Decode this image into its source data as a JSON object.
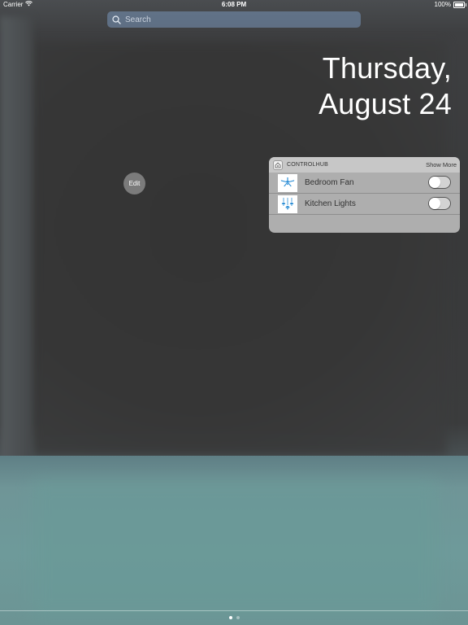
{
  "status_bar": {
    "carrier": "Carrier",
    "time": "6:08 PM",
    "battery": "100%",
    "battery_level": 1.0
  },
  "search": {
    "placeholder": "Search"
  },
  "date": {
    "line1": "Thursday,",
    "line2": "August 24"
  },
  "edit_button": {
    "label": "Edit"
  },
  "widget": {
    "app_name": "CONTROLHUB",
    "show_more": "Show More",
    "items": [
      {
        "label": "Bedroom Fan",
        "icon": "ceiling-fan-icon",
        "enabled": false
      },
      {
        "label": "Kitchen Lights",
        "icon": "pendant-lights-icon",
        "enabled": false
      }
    ]
  },
  "pages": {
    "count": 2,
    "current": 1
  },
  "colors": {
    "icon_blue": "#2e8fd6",
    "search_bg": "#7896b9",
    "widget_bg": "#b9b9b9",
    "teal": "#6e9a9a"
  }
}
